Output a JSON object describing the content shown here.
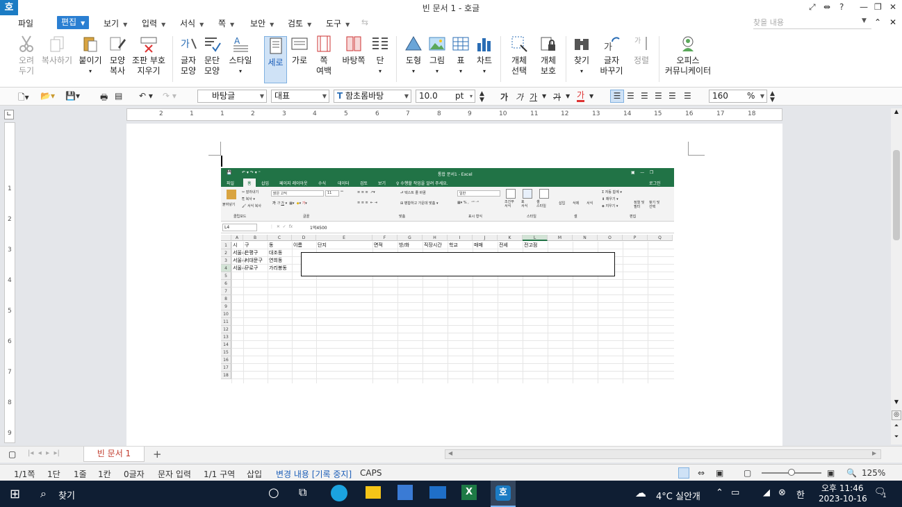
{
  "window": {
    "title": "빈 문서 1 - 호글",
    "logo": "호",
    "help": "?"
  },
  "menu": {
    "items": [
      "파일",
      "편집",
      "보기",
      "입력",
      "서식",
      "쪽",
      "보안",
      "검토",
      "도구"
    ],
    "active_index": 1,
    "search_placeholder": "찾을 내용"
  },
  "ribbon": {
    "cut": "오려\n두기",
    "copy": "복사하기",
    "paste": "붙이기",
    "format_copy": "모양\n복사",
    "clear_marks": "조판 부호\n지우기",
    "char_shape": "글자\n모양",
    "para_shape": "문단\n모양",
    "style": "스타일",
    "portrait": "세로",
    "landscape": "가로",
    "page_margin": "쪽\n여백",
    "page_bg": "바탕쪽",
    "columns": "단",
    "shape": "도형",
    "picture": "그림",
    "table": "표",
    "chart": "차트",
    "obj_select": "개체\n선택",
    "obj_protect": "개체\n보호",
    "find": "찾기",
    "char_change": "글자\n바꾸기",
    "align": "정렬",
    "office_comm": "오피스\n커뮤니케이터"
  },
  "toolbar": {
    "style_value": "바탕글",
    "lang_value": "대표",
    "font_value": "함초롬바탕",
    "font_size": "10.0",
    "unit": "pt",
    "bold": "가",
    "italic": "가",
    "underline": "가",
    "strike": "가",
    "color": "가",
    "zoom_value": "160",
    "zoom_unit": "%"
  },
  "ruler": {
    "h_numbers": [
      "2",
      "1",
      "1",
      "2",
      "3",
      "4",
      "5",
      "6",
      "7",
      "8",
      "9",
      "10",
      "11",
      "12",
      "13",
      "14",
      "15",
      "16",
      "17",
      "18"
    ],
    "v_numbers": [
      "1",
      "2",
      "3",
      "4",
      "5",
      "6",
      "7",
      "8",
      "9"
    ]
  },
  "excel": {
    "title": "통합 문서1 - Excel",
    "tabs": [
      "파일",
      "홈",
      "삽입",
      "페이지 레이아웃",
      "수식",
      "데이터",
      "검토",
      "보기",
      "♀ 수행할 작업을 알려 주세요."
    ],
    "login": "로그인",
    "ribbon": {
      "paste": "붙여넣기",
      "cut": "잘라내기",
      "copy": "복사",
      "format_painter": "서식 복사",
      "clipboard": "클립보드",
      "font_name": "맑은 고딕",
      "font_size": "11",
      "font_group": "글꼴",
      "wrap": "텍스트 줄 바꿈",
      "merge": "병합하고 가운데 맞춤",
      "align_group": "맞춤",
      "num_format": "일반",
      "num_group": "표시 형식",
      "cond": "조건부\n서식",
      "table_fmt": "표\n서식",
      "cell_style": "셀\n스타일",
      "style_group": "스타일",
      "insert": "삽입",
      "delete": "삭제",
      "format": "서식",
      "cell_group": "셀",
      "autosum": "자동 합계",
      "fill": "채우기",
      "clear": "지우기",
      "sort": "정렬 및\n필터",
      "find": "찾기 및\n선택",
      "edit_group": "편집"
    },
    "name_box": "L4",
    "fx": "fx",
    "formula": "1억4500",
    "columns": [
      "A",
      "B",
      "C",
      "D",
      "E",
      "F",
      "G",
      "H",
      "I",
      "J",
      "K",
      "L",
      "M",
      "N",
      "O",
      "P",
      "Q"
    ],
    "rows": [
      "1",
      "2",
      "3",
      "4",
      "5",
      "6",
      "7",
      "8",
      "9",
      "10",
      "11",
      "12",
      "13",
      "14",
      "15",
      "16",
      "17",
      "18"
    ],
    "headers": [
      "시",
      "구",
      "동",
      "이름",
      "단지",
      "면적",
      "방/화",
      "직장시간",
      "학교",
      "매매",
      "전세",
      "전고점"
    ],
    "data": [
      [
        "서울시",
        "은평구",
        "대조동"
      ],
      [
        "서울시",
        "서대문구",
        "연희동"
      ],
      [
        "서울시",
        "구로구",
        "가리봉동"
      ]
    ]
  },
  "tabs": {
    "doc_tab": "빈 문서 1",
    "add": "+"
  },
  "status": {
    "page": "1/1쪽",
    "column": "1단",
    "line": "1줄",
    "col": "1칸",
    "chars": "0글자",
    "input_mode": "문자 입력",
    "section": "1/1 구역",
    "insert": "삽입",
    "track": "변경 내용 [기록 중지]",
    "caps": "CAPS",
    "zoom": "125%"
  },
  "taskbar": {
    "search": "찾기",
    "weather": "4°C  실안개",
    "time": "오후 11:46",
    "date": "2023-10-16",
    "notif": "1",
    "ime": "한"
  }
}
